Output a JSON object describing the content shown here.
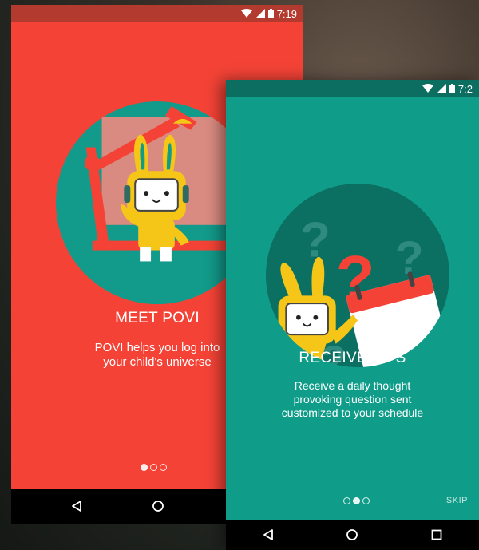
{
  "screens": [
    {
      "status_time": "7:19",
      "title": "MEET POVI",
      "description_line1": "POVI helps you log into",
      "description_line2": "your child's universe",
      "page_count": 3,
      "active_page": 1,
      "colors": {
        "background": "#f44336",
        "statusbar": "#b23a2f",
        "circle": "#129a8a",
        "mascot": "#f5c518"
      }
    },
    {
      "status_time": "7:2",
      "title": "RECEIVE TIPS",
      "description_line1": "Receive a daily thought",
      "description_line2": "provoking question sent",
      "description_line3": "customized to your schedule",
      "skip_label": "SKIP",
      "page_count": 3,
      "active_page": 2,
      "colors": {
        "background": "#0f9d8a",
        "statusbar": "#0b6e61",
        "circle": "#0b6f62",
        "question_mark": "#f44336",
        "mascot": "#f5c518"
      }
    }
  ],
  "nav_icons": [
    "back-icon",
    "home-icon",
    "recents-icon"
  ]
}
